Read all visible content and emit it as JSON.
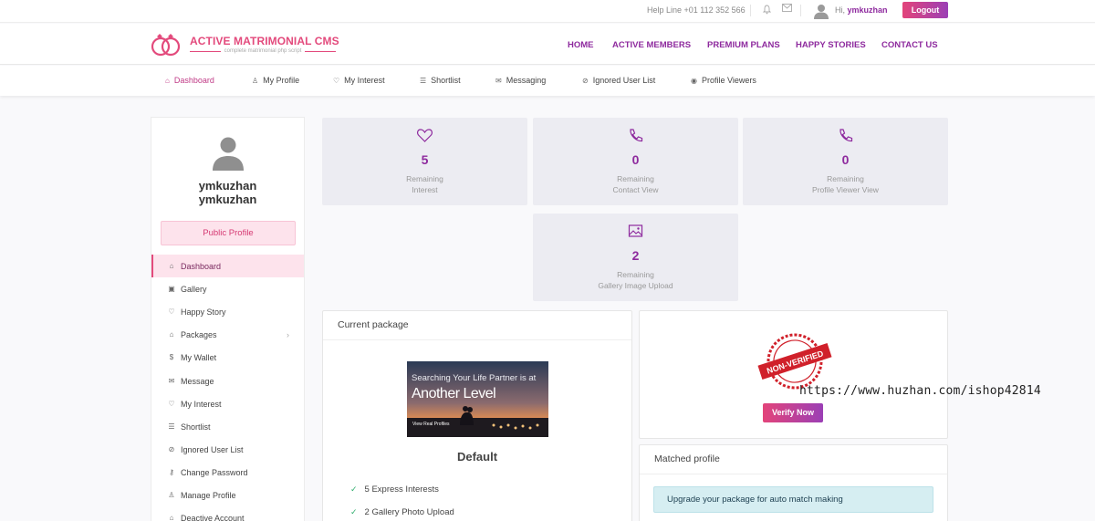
{
  "topbar": {
    "helpline": "Help Line +01 112 352 566",
    "greeting": "Hi,",
    "username": "ymkuzhan",
    "logout_label": "Logout"
  },
  "header": {
    "brand_title": "ACTIVE MATRIMONIAL CMS",
    "brand_subtitle": "complete matrimonial php script",
    "nav": [
      "HOME",
      "ACTIVE MEMBERS",
      "PREMIUM PLANS",
      "HAPPY STORIES",
      "CONTACT US"
    ]
  },
  "subnav": [
    {
      "label": "Dashboard",
      "icon": "home-icon",
      "active": true
    },
    {
      "label": "My Profile",
      "icon": "user-icon"
    },
    {
      "label": "My Interest",
      "icon": "heart-icon"
    },
    {
      "label": "Shortlist",
      "icon": "list-icon"
    },
    {
      "label": "Messaging",
      "icon": "mail-icon"
    },
    {
      "label": "Ignored User List",
      "icon": "ban-icon"
    },
    {
      "label": "Profile Viewers",
      "icon": "eye-icon"
    }
  ],
  "sidebar": {
    "name_line1": "ymkuzhan",
    "name_line2": "ymkuzhan",
    "public_profile_label": "Public Profile",
    "items": [
      {
        "label": "Dashboard",
        "icon": "home-icon",
        "active": true
      },
      {
        "label": "Gallery",
        "icon": "image-icon"
      },
      {
        "label": "Happy Story",
        "icon": "hearts-icon"
      },
      {
        "label": "Packages",
        "icon": "package-icon",
        "has_submenu": true
      },
      {
        "label": "My Wallet",
        "icon": "dollar-icon"
      },
      {
        "label": "Message",
        "icon": "mail-icon"
      },
      {
        "label": "My Interest",
        "icon": "heart-icon"
      },
      {
        "label": "Shortlist",
        "icon": "list-icon"
      },
      {
        "label": "Ignored User List",
        "icon": "ban-icon"
      },
      {
        "label": "Change Password",
        "icon": "key-icon"
      },
      {
        "label": "Manage Profile",
        "icon": "user-icon"
      },
      {
        "label": "Deactive Account",
        "icon": "lock-icon"
      }
    ]
  },
  "stats": [
    {
      "icon": "heart-icon",
      "value": "5",
      "label1": "Remaining",
      "label2": "Interest"
    },
    {
      "icon": "phone-icon",
      "value": "0",
      "label1": "Remaining",
      "label2": "Contact View"
    },
    {
      "icon": "phone-icon",
      "value": "0",
      "label1": "Remaining",
      "label2": "Profile Viewer View"
    },
    {
      "icon": "gallery-icon",
      "value": "2",
      "label1": "Remaining",
      "label2": "Gallery Image Upload"
    }
  ],
  "current_package": {
    "heading": "Current package",
    "banner_line1": "Searching Your Life Partner is at",
    "banner_line2": "Another Level",
    "banner_line3": "View Real Profiles",
    "name": "Default",
    "features": [
      "5 Express Interests",
      "2 Gallery Photo Upload"
    ]
  },
  "verification": {
    "stamp_text": "NON-VERIFIED",
    "verify_label": "Verify Now"
  },
  "matched_profile": {
    "heading": "Matched profile",
    "alert": "Upgrade your package for auto match making"
  },
  "watermark": "https://www.huzhan.com/ishop42814",
  "colors": {
    "brand_pink": "#e34a7c",
    "brand_purple": "#8e2a9e",
    "card_bg": "#ececf2"
  }
}
